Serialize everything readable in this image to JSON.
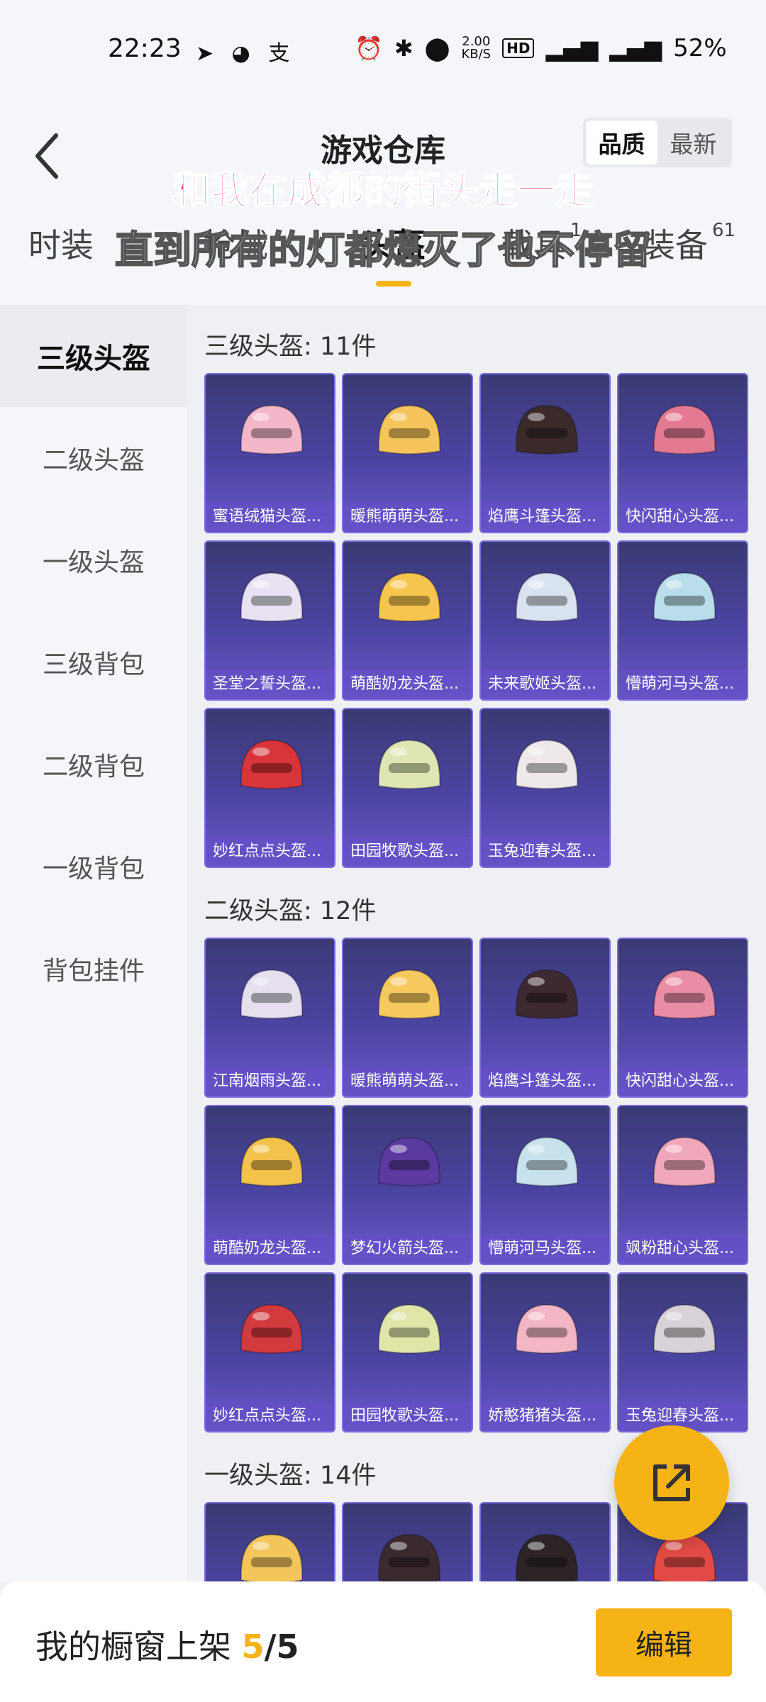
{
  "status": {
    "time": "22:23",
    "speed": "2.00",
    "speed_unit": "KB/S",
    "battery": "52%",
    "hd": "HD"
  },
  "header": {
    "title": "游戏仓库",
    "sort_options": [
      "品质",
      "最新"
    ],
    "sort_active": "品质",
    "lyric_line1": "和我在成都的街头走一走",
    "lyric_line2": "直到所有的灯都熄灭了也不停留"
  },
  "tabs": [
    {
      "label": "时装",
      "count": ""
    },
    {
      "label": "枪械",
      "count": ""
    },
    {
      "label": "头盔",
      "count": ""
    },
    {
      "label": "载具",
      "count": "1"
    },
    {
      "label": "装备",
      "count": "61"
    }
  ],
  "sidebar": {
    "items": [
      {
        "label": "三级头盔",
        "active": true
      },
      {
        "label": "二级头盔",
        "active": false
      },
      {
        "label": "一级头盔",
        "active": false
      },
      {
        "label": "三级背包",
        "active": false
      },
      {
        "label": "二级背包",
        "active": false
      },
      {
        "label": "一级背包",
        "active": false
      },
      {
        "label": "背包挂件",
        "active": false
      }
    ]
  },
  "sections": [
    {
      "title": "三级头盔: 11件",
      "items": [
        {
          "name": "蜜语绒猫头盔...",
          "color": "#f3b7c9"
        },
        {
          "name": "暖熊萌萌头盔...",
          "color": "#f5c45a"
        },
        {
          "name": "焰鹰斗篷头盔...",
          "color": "#3a2a2a"
        },
        {
          "name": "快闪甜心头盔...",
          "color": "#e47a92"
        },
        {
          "name": "圣堂之誓头盔...",
          "color": "#e8e2f2"
        },
        {
          "name": "萌酷奶龙头盔...",
          "color": "#f6c54e"
        },
        {
          "name": "未来歌姬头盔...",
          "color": "#d9e3f0"
        },
        {
          "name": "懵萌河马头盔...",
          "color": "#b9ddea"
        },
        {
          "name": "妙红点点头盔...",
          "color": "#d8353b"
        },
        {
          "name": "田园牧歌头盔...",
          "color": "#dfe6b4"
        },
        {
          "name": "玉兔迎春头盔...",
          "color": "#efe8ea"
        }
      ]
    },
    {
      "title": "二级头盔: 12件",
      "items": [
        {
          "name": "江南烟雨头盔...",
          "color": "#e5dfee"
        },
        {
          "name": "暖熊萌萌头盔...",
          "color": "#f6c95e"
        },
        {
          "name": "焰鹰斗篷头盔...",
          "color": "#3c2a30"
        },
        {
          "name": "快闪甜心头盔...",
          "color": "#e98ca6"
        },
        {
          "name": "萌酷奶龙头盔...",
          "color": "#f2c24a"
        },
        {
          "name": "梦幻火箭头盔...",
          "color": "#5a3aa0"
        },
        {
          "name": "懵萌河马头盔...",
          "color": "#c7e2ec"
        },
        {
          "name": "飒粉甜心头盔...",
          "color": "#f1a7bb"
        },
        {
          "name": "妙红点点头盔...",
          "color": "#d33a3e"
        },
        {
          "name": "田园牧歌头盔...",
          "color": "#dfe6a8"
        },
        {
          "name": "娇憨猪猪头盔...",
          "color": "#f3b6c4"
        },
        {
          "name": "玉兔迎春头盔...",
          "color": "#d8d2d8"
        }
      ]
    },
    {
      "title": "一级头盔: 14件",
      "items": [
        {
          "name": "",
          "color": "#f3c65c"
        },
        {
          "name": "",
          "color": "#3a2a2e"
        },
        {
          "name": "",
          "color": "#2d2426"
        },
        {
          "name": "",
          "color": "#e24a45"
        }
      ]
    }
  ],
  "bottom": {
    "label": "我的橱窗上架",
    "count_on": "5",
    "count_sep": "/",
    "count_total": "5",
    "edit_label": "编辑"
  },
  "colors": {
    "accent": "#f6b315",
    "card_bg": "#4b44a2",
    "lyric_pink": "#e23a8d"
  }
}
